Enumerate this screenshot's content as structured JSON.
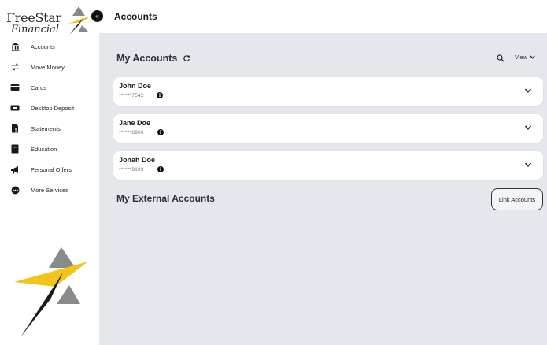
{
  "app": {
    "logo": {
      "line1": "FreeStar",
      "line2": "Financial"
    }
  },
  "header": {
    "title": "Accounts"
  },
  "sidebar": {
    "items": [
      {
        "label": "Accounts",
        "icon": "bank-icon"
      },
      {
        "label": "Move Money",
        "icon": "transfer-icon"
      },
      {
        "label": "Cards",
        "icon": "card-icon"
      },
      {
        "label": "Desktop Deposit",
        "icon": "deposit-icon"
      },
      {
        "label": "Statements",
        "icon": "statements-icon"
      },
      {
        "label": "Education",
        "icon": "education-icon"
      },
      {
        "label": "Personal Offers",
        "icon": "megaphone-icon"
      },
      {
        "label": "More Services",
        "icon": "more-icon"
      }
    ]
  },
  "main": {
    "my_accounts_title": "My Accounts",
    "view_label": "View",
    "accounts": [
      {
        "name": "John Doe",
        "number": "******7542"
      },
      {
        "name": "Jane Doe",
        "number": "******8906"
      },
      {
        "name": "Jonah Doe",
        "number": "******9109"
      }
    ],
    "external_title": "My External Accounts",
    "link_button": "Link Accounts"
  },
  "colors": {
    "brand_gold": "#f0c419",
    "brand_dark": "#1a1a1a",
    "brand_gray": "#8a8a8a",
    "content_bg": "#e4e7ec"
  }
}
